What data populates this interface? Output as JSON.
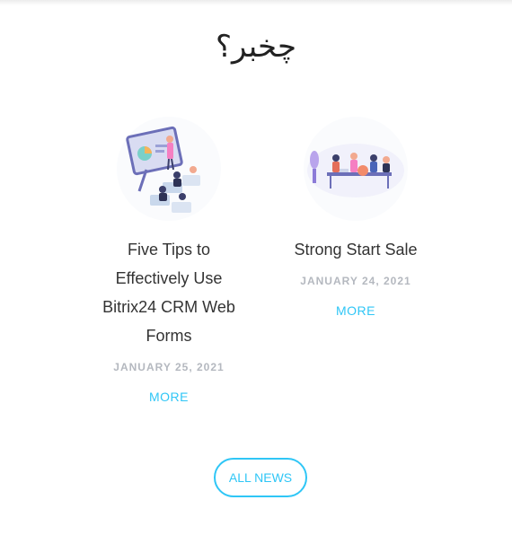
{
  "section": {
    "heading": "چخبر؟"
  },
  "cards": [
    {
      "title": "Five Tips to Effectively Use Bitrix24 CRM Web Forms",
      "date": "JANUARY 25, 2021",
      "more": "MORE",
      "illustration": "presentation-illustration"
    },
    {
      "title": "Strong Start Sale",
      "date": "JANUARY 24, 2021",
      "more": "MORE",
      "illustration": "meeting-illustration"
    }
  ],
  "all_news": "ALL NEWS",
  "colors": {
    "accent": "#2fc6f6",
    "date": "#b4b8bf",
    "title": "#333333"
  }
}
